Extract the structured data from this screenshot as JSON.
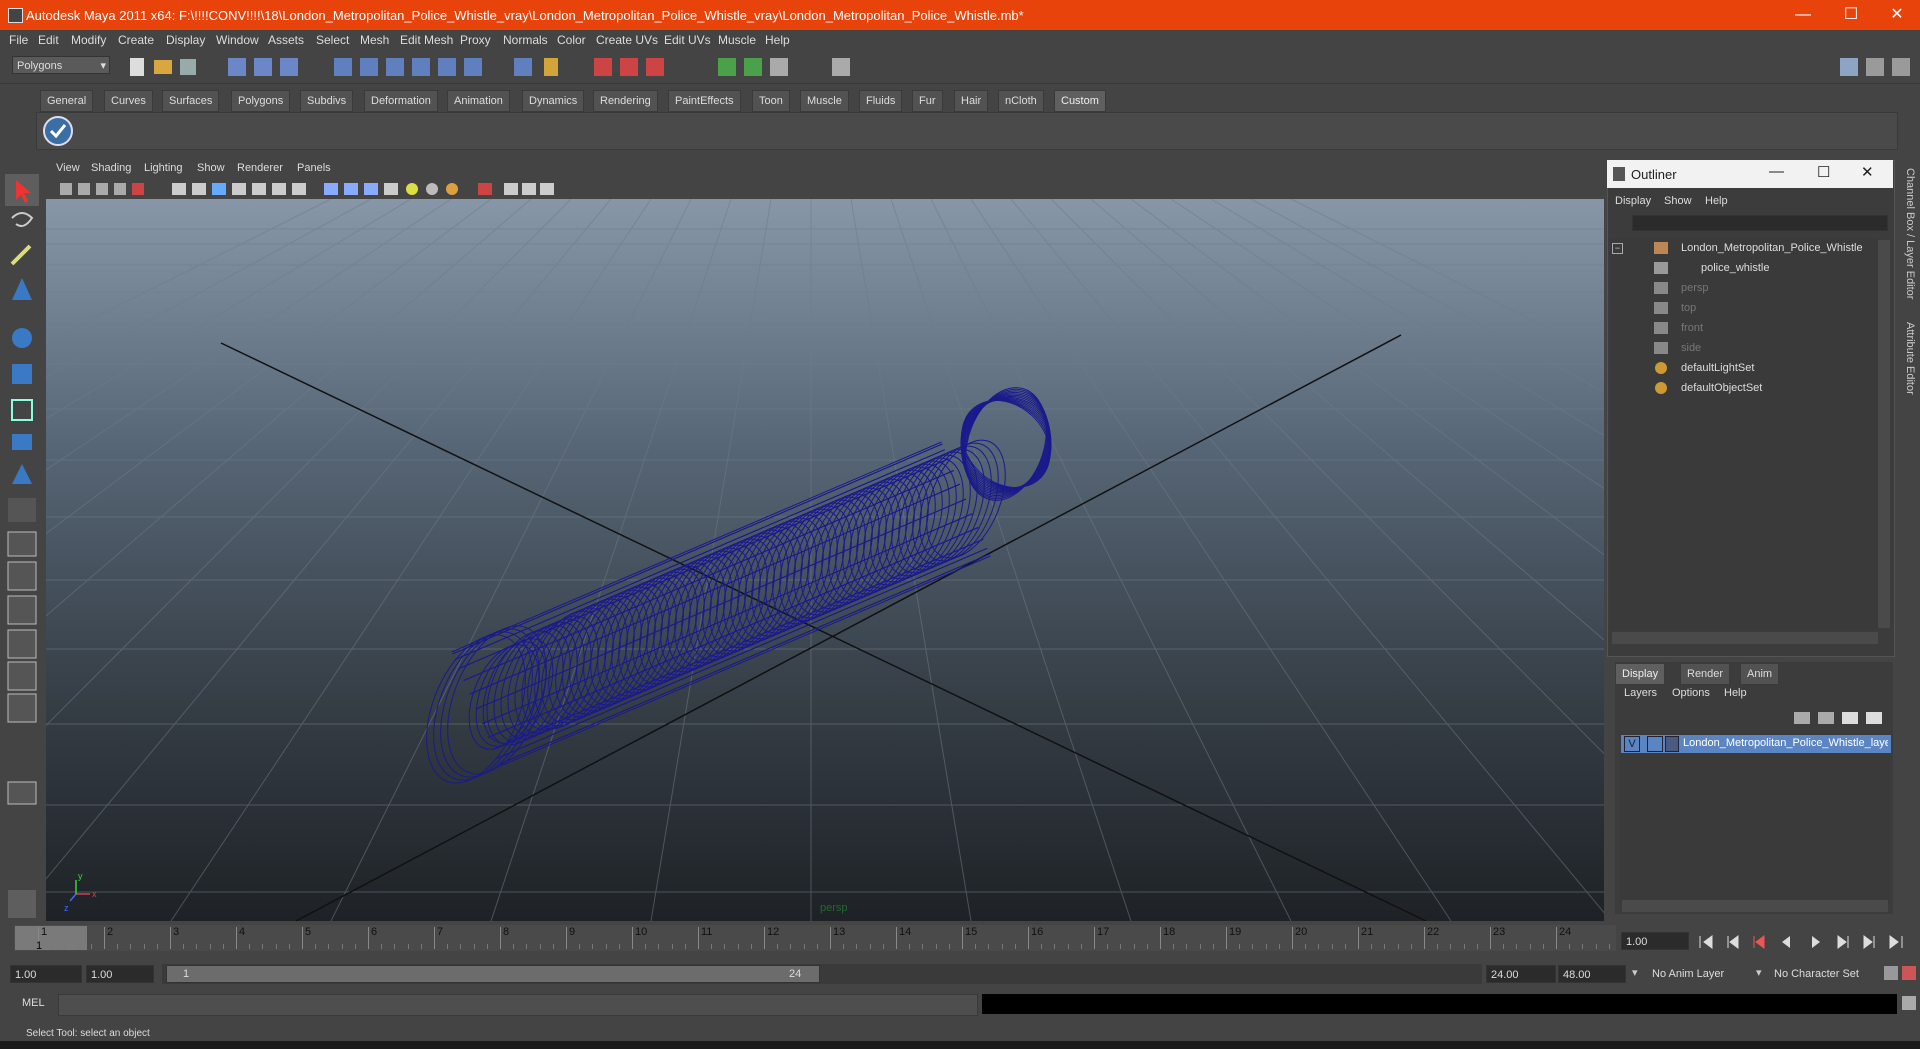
{
  "window": {
    "title": "Autodesk Maya 2011 x64: F:\\!!!!CONV!!!!\\18\\London_Metropolitan_Police_Whistle_vray\\London_Metropolitan_Police_Whistle_vray\\London_Metropolitan_Police_Whistle.mb*",
    "minimize": "—",
    "maximize": "☐",
    "close": "✕"
  },
  "menus": [
    "File",
    "Edit",
    "Modify",
    "Create",
    "Display",
    "Window",
    "Assets",
    "Select",
    "Mesh",
    "Edit Mesh",
    "Proxy",
    "Normals",
    "Color",
    "Create UVs",
    "Edit UVs",
    "Muscle",
    "Help"
  ],
  "toolbar": {
    "mode_select": "Polygons"
  },
  "shelf_tabs": [
    "General",
    "Curves",
    "Surfaces",
    "Polygons",
    "Subdivs",
    "Deformation",
    "Animation",
    "Dynamics",
    "Rendering",
    "PaintEffects",
    "Toon",
    "Muscle",
    "Fluids",
    "Fur",
    "Hair",
    "nCloth",
    "Custom"
  ],
  "shelf_active": "Custom",
  "viewport": {
    "menus": [
      "View",
      "Shading",
      "Lighting",
      "Show",
      "Renderer",
      "Panels"
    ],
    "camera_label": "persp",
    "axis": {
      "x": "x",
      "y": "y",
      "z": "z"
    },
    "wire_color": "#1a1a8c"
  },
  "outliner": {
    "title": "Outliner",
    "menus": [
      "Display",
      "Show",
      "Help"
    ],
    "items": [
      {
        "label": "London_Metropolitan_Police_Whistle",
        "dim": false
      },
      {
        "label": "police_whistle",
        "dim": false
      },
      {
        "label": "persp",
        "dim": true
      },
      {
        "label": "top",
        "dim": true
      },
      {
        "label": "front",
        "dim": true
      },
      {
        "label": "side",
        "dim": true
      },
      {
        "label": "defaultLightSet",
        "dim": false
      },
      {
        "label": "defaultObjectSet",
        "dim": false
      }
    ]
  },
  "layer_editor": {
    "tabs": [
      "Display",
      "Render",
      "Anim"
    ],
    "active_tab": "Display",
    "menus": [
      "Layers",
      "Options",
      "Help"
    ],
    "layer": {
      "visible": "V",
      "name": "London_Metropolitan_Police_Whistle_layer"
    }
  },
  "side_tabs": [
    "Channel Box / Layer Editor",
    "Attribute Editor"
  ],
  "timeline": {
    "ticks": [
      "1",
      "2",
      "3",
      "4",
      "5",
      "6",
      "7",
      "8",
      "9",
      "10",
      "11",
      "12",
      "13",
      "14",
      "15",
      "16",
      "17",
      "18",
      "19",
      "20",
      "21",
      "22",
      "23",
      "24"
    ],
    "current_frame_marker": "1",
    "current_time": "1.00"
  },
  "range": {
    "start": "1.00",
    "playback_start": "1.00",
    "slider_start": "1",
    "slider_end": "24",
    "playback_end": "24.00",
    "end": "48.00",
    "anim_layer": "No Anim Layer",
    "character_set": "No Character Set"
  },
  "mel": {
    "label": "MEL"
  },
  "help_line": "Select Tool: select an object"
}
